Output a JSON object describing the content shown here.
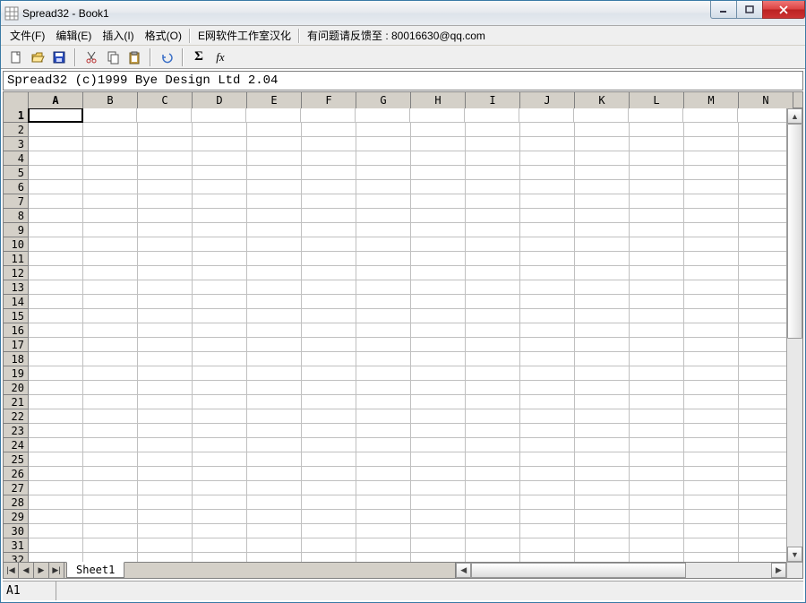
{
  "window": {
    "title": "Spread32 - Book1"
  },
  "menubar": {
    "file": "文件(F)",
    "edit": "编辑(E)",
    "insert": "插入(I)",
    "format": "格式(O)",
    "studio": "E网软件工作室汉化",
    "feedback": "有问题请反馈至 : 80016630@qq.com"
  },
  "toolbar": {
    "sigma": "Σ",
    "fx": "fx"
  },
  "formula_bar": "Spread32 (c)1999 Bye Design Ltd  2.04",
  "columns": [
    "A",
    "B",
    "C",
    "D",
    "E",
    "F",
    "G",
    "H",
    "I",
    "J",
    "K",
    "L",
    "M",
    "N"
  ],
  "rows": [
    1,
    2,
    3,
    4,
    5,
    6,
    7,
    8,
    9,
    10,
    11,
    12,
    13,
    14,
    15,
    16,
    17,
    18,
    19,
    20,
    21,
    22,
    23,
    24,
    25,
    26,
    27,
    28,
    29,
    30,
    31,
    32
  ],
  "active_cell": "A1",
  "sheet_tab": "Sheet1",
  "status": {
    "cell_ref": "A1"
  }
}
